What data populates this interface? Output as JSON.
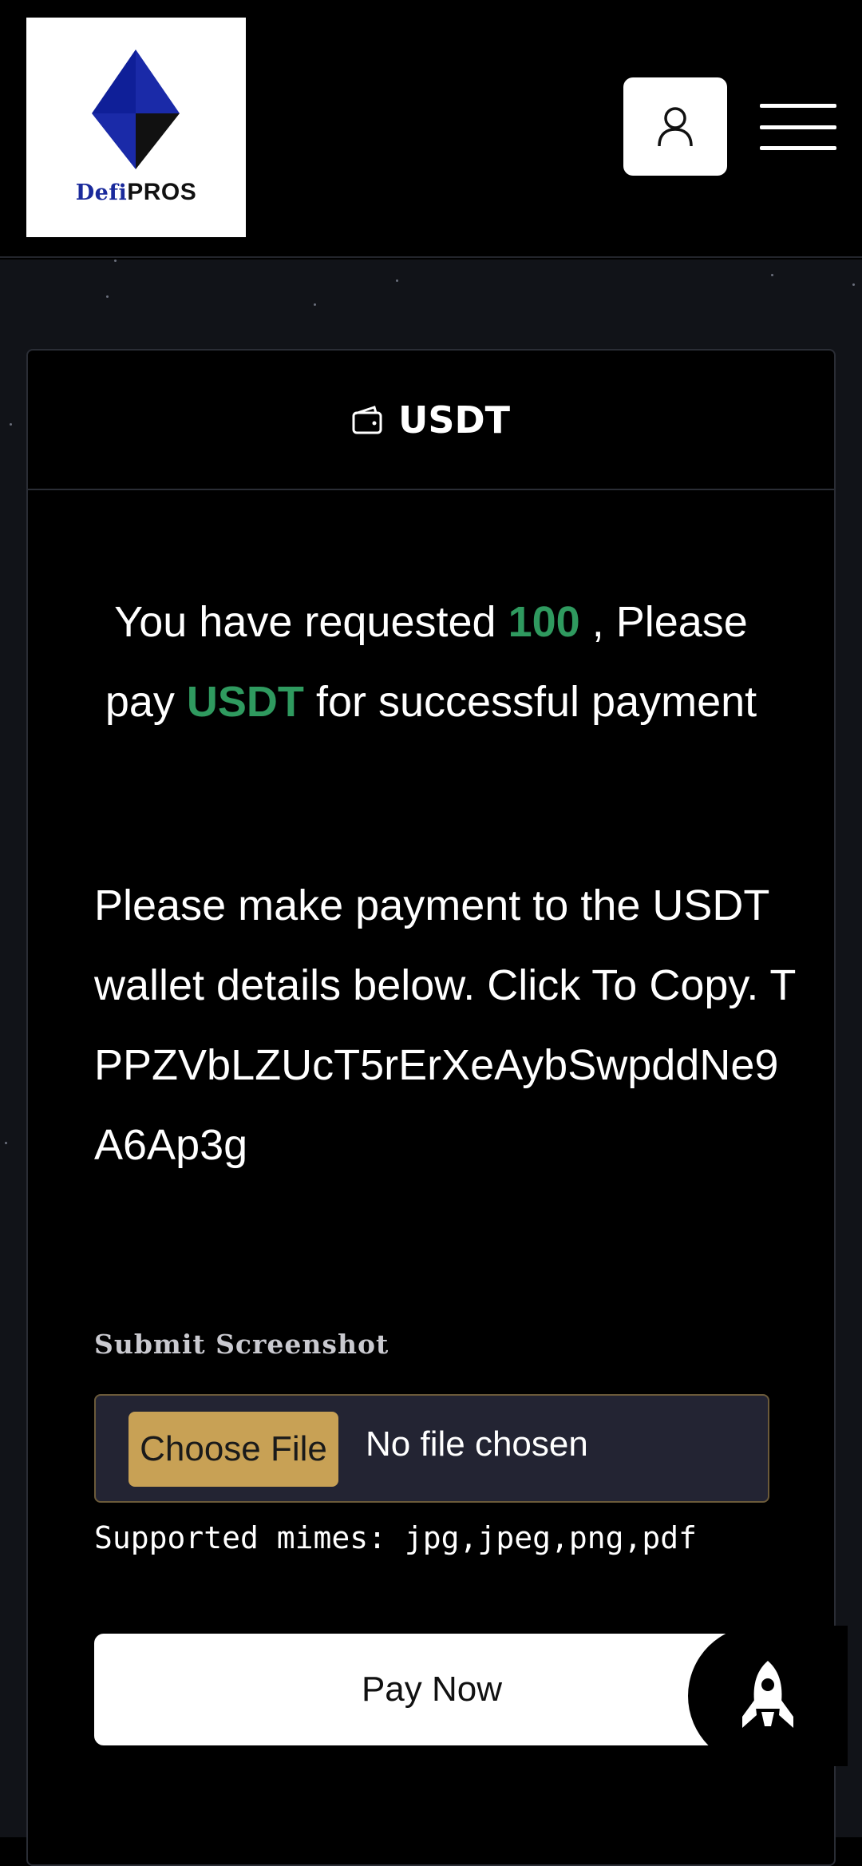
{
  "header": {
    "logo": {
      "brand_prefix": "Defi",
      "brand_suffix": "PROS"
    },
    "user_icon": "user-icon",
    "menu_icon": "hamburger-menu-icon"
  },
  "card": {
    "header_icon": "wallet-icon",
    "title": "USDT",
    "request": {
      "prefix": "You have requested",
      "amount": "100",
      "middle": ", Please pay",
      "currency": "USDT",
      "suffix": "for successful payment"
    },
    "instructions": "Please make payment to the USDT wallet details below. Click To Copy.",
    "wallet_address": "TPPZVbLZUcT5rErXeAybSwpddNe9A6Ap3g",
    "upload": {
      "label": "Submit Screenshot",
      "choose_label": "Choose File",
      "status": "No file chosen",
      "hint": "Supported mimes: jpg,jpeg,png,pdf"
    },
    "pay_button": "Pay Now"
  },
  "fab": {
    "icon": "rocket-icon"
  },
  "colors": {
    "accent_green": "#2f9a5f",
    "choose_file_gold": "#c8a155",
    "logo_blue": "#1a2a9c"
  }
}
